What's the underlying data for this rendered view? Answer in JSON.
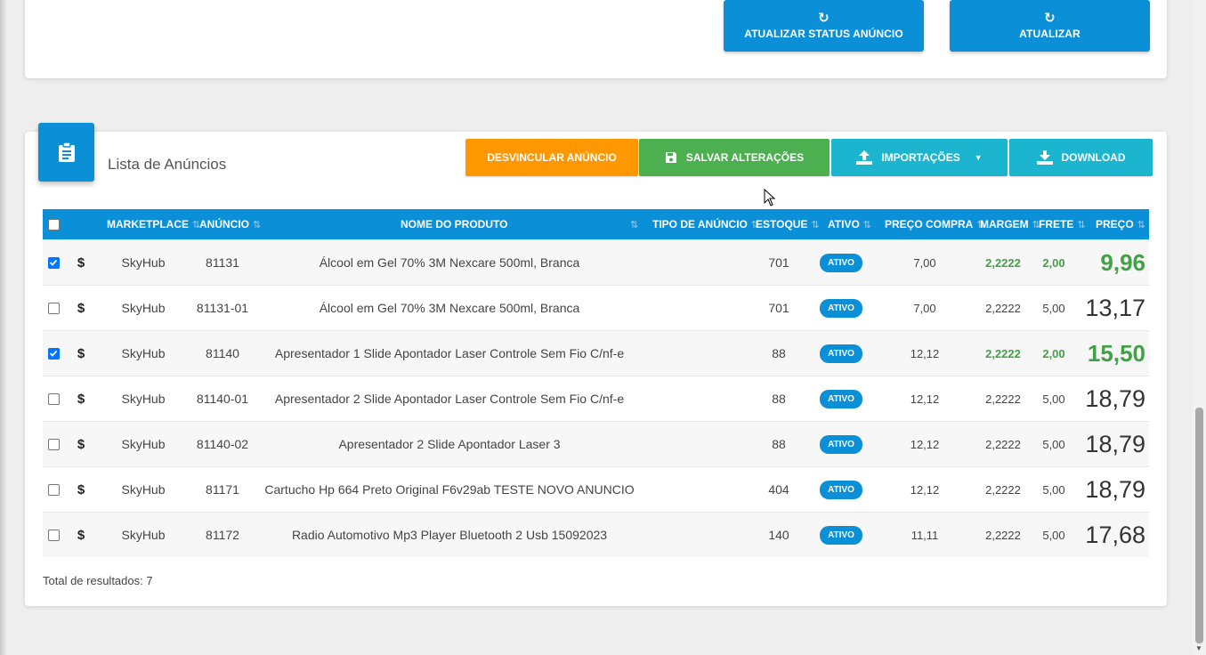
{
  "top_buttons": {
    "status_label": "ATUALIZAR STATUS ANÚNCIO",
    "update_label": "ATUALIZAR"
  },
  "card": {
    "title": "Lista de Anúncios"
  },
  "toolbar": {
    "unlink_label": "DESVINCULAR ANÚNCIO",
    "save_label": "SALVAR ALTERAÇÕES",
    "import_label": "IMPORTAÇÕES",
    "download_label": "DOWNLOAD"
  },
  "colors": {
    "primary": "#0b8fd6",
    "warning": "#ff9800",
    "success": "#4caf50",
    "info": "#1cb5cf",
    "green_text": "#43a047"
  },
  "table": {
    "headers": {
      "marketplace": "MARKETPLACE",
      "anuncio": "ANÚNCIO",
      "nome": "NOME DO PRODUTO",
      "tipo": "TIPO DE ANÚNCIO",
      "estoque": "ESTOQUE",
      "ativo": "ATIVO",
      "preco_compra": "PREÇO COMPRA",
      "margem": "MARGEM",
      "frete": "FRETE",
      "preco": "PREÇO"
    },
    "rows": [
      {
        "checked": true,
        "marketplace": "SkyHub",
        "anuncio": "81131",
        "nome": "Álcool em Gel 70% 3M Nexcare 500ml, Branca",
        "estoque": "701",
        "ativo": "ATIVO",
        "preco_compra": "7,00",
        "margem": "2,2222",
        "frete": "2,00",
        "preco": "9,96"
      },
      {
        "checked": false,
        "marketplace": "SkyHub",
        "anuncio": "81131-01",
        "nome": "Álcool em Gel 70% 3M Nexcare 500ml, Branca",
        "estoque": "701",
        "ativo": "ATIVO",
        "preco_compra": "7,00",
        "margem": "2,2222",
        "frete": "5,00",
        "preco": "13,17"
      },
      {
        "checked": true,
        "marketplace": "SkyHub",
        "anuncio": "81140",
        "nome": "Apresentador 1 Slide Apontador Laser Controle Sem Fio C/nf-e",
        "estoque": "88",
        "ativo": "ATIVO",
        "preco_compra": "12,12",
        "margem": "2,2222",
        "frete": "2,00",
        "preco": "15,50"
      },
      {
        "checked": false,
        "marketplace": "SkyHub",
        "anuncio": "81140-01",
        "nome": "Apresentador 2 Slide Apontador Laser Controle Sem Fio C/nf-e",
        "estoque": "88",
        "ativo": "ATIVO",
        "preco_compra": "12,12",
        "margem": "2,2222",
        "frete": "5,00",
        "preco": "18,79"
      },
      {
        "checked": false,
        "marketplace": "SkyHub",
        "anuncio": "81140-02",
        "nome": "Apresentador 2 Slide Apontador Laser 3",
        "estoque": "88",
        "ativo": "ATIVO",
        "preco_compra": "12,12",
        "margem": "2,2222",
        "frete": "5,00",
        "preco": "18,79"
      },
      {
        "checked": false,
        "marketplace": "SkyHub",
        "anuncio": "81171",
        "nome": "Cartucho Hp 664 Preto Original F6v29ab TESTE NOVO ANUNCIO",
        "estoque": "404",
        "ativo": "ATIVO",
        "preco_compra": "12,12",
        "margem": "2,2222",
        "frete": "5,00",
        "preco": "18,79"
      },
      {
        "checked": false,
        "marketplace": "SkyHub",
        "anuncio": "81172",
        "nome": "Radio Automotivo Mp3 Player Bluetooth 2 Usb 15092023",
        "estoque": "140",
        "ativo": "ATIVO",
        "preco_compra": "11,11",
        "margem": "2,2222",
        "frete": "5,00",
        "preco": "17,68"
      }
    ]
  },
  "footer": {
    "total_label": "Total de resultados: 7"
  }
}
